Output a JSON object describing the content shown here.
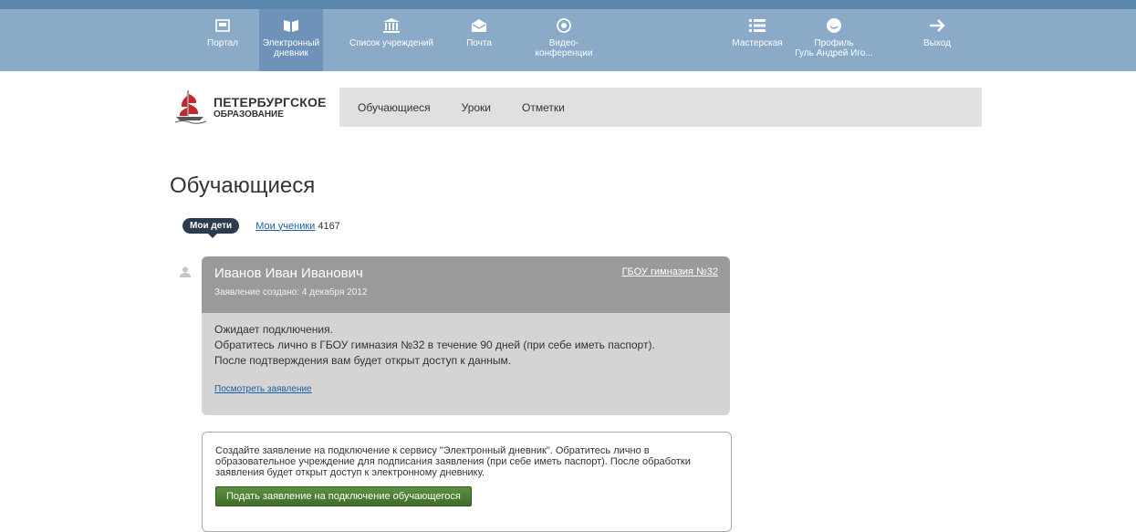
{
  "topnav": {
    "items": [
      {
        "label": "Портал",
        "icon": "portal-icon"
      },
      {
        "label": "Электронный дневник",
        "icon": "book-icon",
        "active": true
      },
      {
        "label": "Список учреждений",
        "icon": "institution-icon"
      },
      {
        "label": "Почта",
        "icon": "mail-icon"
      },
      {
        "label": "Видео-конференции",
        "icon": "video-icon"
      },
      {
        "label": "Мастерская",
        "icon": "list-icon"
      },
      {
        "label": "Профиль",
        "icon": "profile-icon"
      },
      {
        "label": "Выход",
        "icon": "arrow-right-icon"
      }
    ],
    "profile_user": "Гуль Андрей Иго...",
    "colors": {
      "bar": "#8aaac8",
      "active": "#6f93b8",
      "stripe": "#5b86ad"
    }
  },
  "brand": {
    "line1": "ПЕТЕРБУРГСКОЕ",
    "line2": "ОБРАЗОВАНИЕ"
  },
  "subnav": {
    "items": [
      "Обучающиеся",
      "Уроки",
      "Отметки"
    ]
  },
  "page": {
    "title": "Обучающиеся"
  },
  "tabs": {
    "my_children": "Мои дети",
    "my_students": "Мои ученики",
    "students_count": "4167"
  },
  "student": {
    "name": "Иванов Иван Иванович",
    "created": "Заявление создано: 4 декабря 2012",
    "school": "ГБОУ гимназия №32",
    "status_line1": "Ожидает подключения.",
    "status_line2": "Обратитесь лично в ГБОУ гимназия №32 в течение 90 дней (при себе иметь паспорт).",
    "status_line3": "После подтверждения вам будет открыт доступ к данным.",
    "view_link": "Посмотреть заявление"
  },
  "apply": {
    "text": "Создайте заявление на подключение к сервису \"Электронный дневник\". Обратитесь лично в образовательное учреждение для подписания заявления (при себе иметь паспорт). После обработки заявления будет открыт доступ к электронному дневнику.",
    "button": "Подать заявление на подключение обучающегося",
    "button_color": "#4d7f35"
  }
}
